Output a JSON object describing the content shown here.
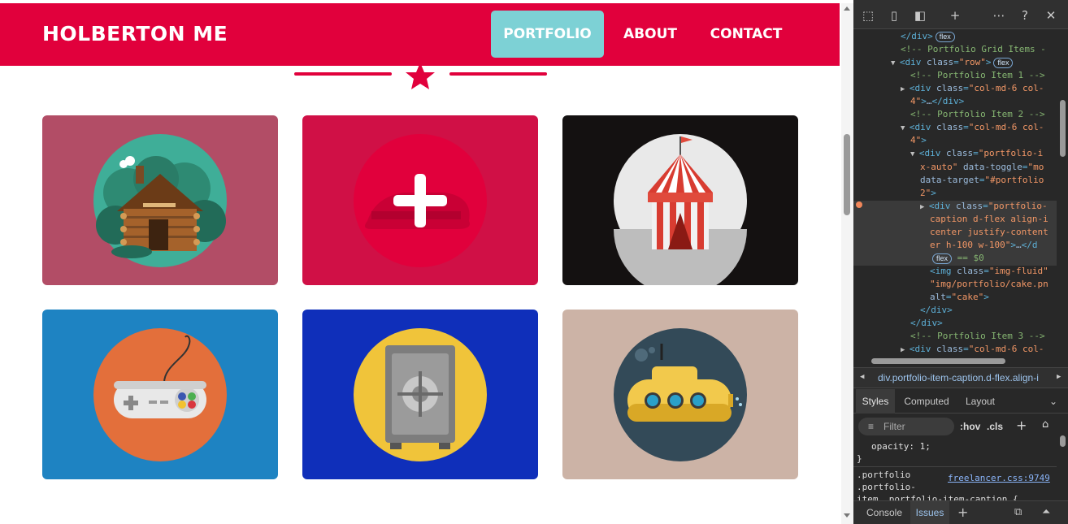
{
  "site": {
    "brand": "HOLBERTON ME",
    "nav": [
      "PORTFOLIO",
      "ABOUT",
      "CONTACT"
    ],
    "active_nav": "PORTFOLIO",
    "accent_color": "#e1003c",
    "active_nav_color": "#7dd1d5",
    "portfolio_items": [
      {
        "icon": "log-cabin-icon",
        "bg": "#b24d66"
      },
      {
        "icon": "cake-plus-icon",
        "bg": "#d01046"
      },
      {
        "icon": "circus-tent-icon",
        "bg": "#141111"
      },
      {
        "icon": "game-controller-icon",
        "bg": "#1e83c2"
      },
      {
        "icon": "safe-icon",
        "bg": "#0f2fba"
      },
      {
        "icon": "submarine-icon",
        "bg": "#ccb3a6"
      }
    ]
  },
  "devtools": {
    "tree": [
      {
        "indent": 0,
        "parts": [
          [
            "tag",
            "</div>"
          ]
        ],
        "badge": "flex"
      },
      {
        "indent": 0,
        "parts": [
          [
            "cm",
            "<!-- Portfolio Grid Items -"
          ]
        ]
      },
      {
        "indent": 0,
        "tri": "▼",
        "parts": [
          [
            "tag",
            "<div "
          ],
          [
            "attr",
            "class"
          ],
          [
            "tag",
            "="
          ],
          [
            "val",
            "\"row\""
          ],
          [
            "tag",
            ">"
          ]
        ],
        "badge": "flex"
      },
      {
        "indent": 1,
        "parts": [
          [
            "cm",
            "<!-- Portfolio Item 1 -->"
          ]
        ]
      },
      {
        "indent": 1,
        "tri": "▶",
        "parts": [
          [
            "tag",
            "<div "
          ],
          [
            "attr",
            "class"
          ],
          [
            "tag",
            "="
          ],
          [
            "val",
            "\"col-md-6 col-"
          ]
        ]
      },
      {
        "indent": 1,
        "parts": [
          [
            "val",
            "4\""
          ],
          [
            "tag",
            ">"
          ],
          [
            "attr",
            "…"
          ],
          [
            "tag",
            "</div>"
          ]
        ]
      },
      {
        "indent": 1,
        "parts": [
          [
            "cm",
            "<!-- Portfolio Item 2 -->"
          ]
        ]
      },
      {
        "indent": 1,
        "tri": "▼",
        "parts": [
          [
            "tag",
            "<div "
          ],
          [
            "attr",
            "class"
          ],
          [
            "tag",
            "="
          ],
          [
            "val",
            "\"col-md-6 col-"
          ]
        ]
      },
      {
        "indent": 1,
        "parts": [
          [
            "val",
            "4\""
          ],
          [
            "tag",
            ">"
          ]
        ]
      },
      {
        "indent": 2,
        "tri": "▼",
        "parts": [
          [
            "tag",
            "<div "
          ],
          [
            "attr",
            "class"
          ],
          [
            "tag",
            "="
          ],
          [
            "val",
            "\"portfolio-i"
          ]
        ]
      },
      {
        "indent": 2,
        "parts": [
          [
            "val",
            "x-auto\" "
          ],
          [
            "attr",
            "data-toggle"
          ],
          [
            "tag",
            "="
          ],
          [
            "val",
            "\"mo"
          ]
        ]
      },
      {
        "indent": 2,
        "parts": [
          [
            "attr",
            "data-target"
          ],
          [
            "tag",
            "="
          ],
          [
            "val",
            "\"#portfolio"
          ]
        ]
      },
      {
        "indent": 2,
        "parts": [
          [
            "val",
            "2\""
          ],
          [
            "tag",
            ">"
          ]
        ]
      },
      {
        "indent": 3,
        "tri": "▶",
        "parts": [
          [
            "tag",
            "<div "
          ],
          [
            "attr",
            "class"
          ],
          [
            "tag",
            "="
          ],
          [
            "val",
            "\"portfolio-"
          ]
        ]
      },
      {
        "indent": 3,
        "parts": [
          [
            "val",
            "caption d-flex align-i"
          ]
        ]
      },
      {
        "indent": 3,
        "parts": [
          [
            "val",
            "center justify-content"
          ]
        ]
      },
      {
        "indent": 3,
        "parts": [
          [
            "val",
            "er h-100 w-100\""
          ],
          [
            "tag",
            ">"
          ],
          [
            "attr",
            "…"
          ],
          [
            "tag",
            "</d"
          ]
        ]
      },
      {
        "indent": 3,
        "parts": [
          [
            "cm",
            "== $0"
          ]
        ],
        "badge_before": "flex"
      },
      {
        "indent": 3,
        "parts": [
          [
            "tag",
            "<img "
          ],
          [
            "attr",
            "class"
          ],
          [
            "tag",
            "="
          ],
          [
            "val",
            "\"img-fluid\""
          ]
        ]
      },
      {
        "indent": 3,
        "parts": [
          [
            "val",
            "\"img/portfolio/cake.pn"
          ]
        ]
      },
      {
        "indent": 3,
        "parts": [
          [
            "attr",
            "alt"
          ],
          [
            "tag",
            "="
          ],
          [
            "val",
            "\"cake\""
          ],
          [
            "tag",
            ">"
          ]
        ]
      },
      {
        "indent": 2,
        "parts": [
          [
            "tag",
            "</div>"
          ]
        ]
      },
      {
        "indent": 1,
        "parts": [
          [
            "tag",
            "</div>"
          ]
        ]
      },
      {
        "indent": 1,
        "parts": [
          [
            "cm",
            "<!-- Portfolio Item 3 -->"
          ]
        ]
      },
      {
        "indent": 1,
        "tri": "▶",
        "parts": [
          [
            "tag",
            "<div "
          ],
          [
            "attr",
            "class"
          ],
          [
            "tag",
            "="
          ],
          [
            "val",
            "\"col-md-6 col-"
          ]
        ]
      }
    ],
    "breadcrumb": "div.portfolio-item-caption.d-flex.align-i",
    "tabs": [
      "Styles",
      "Computed",
      "Layout"
    ],
    "filter_placeholder": "Filter",
    "hov": ":hov",
    "cls": ".cls",
    "style_decl": "opacity: 1;",
    "style_close": "}",
    "selector_lines": [
      ".portfolio",
      ".portfolio-",
      "item .portfolio-item-caption {"
    ],
    "source_link": "freelancer.css:9749",
    "drawer_tabs": [
      "Console",
      "Issues"
    ]
  }
}
